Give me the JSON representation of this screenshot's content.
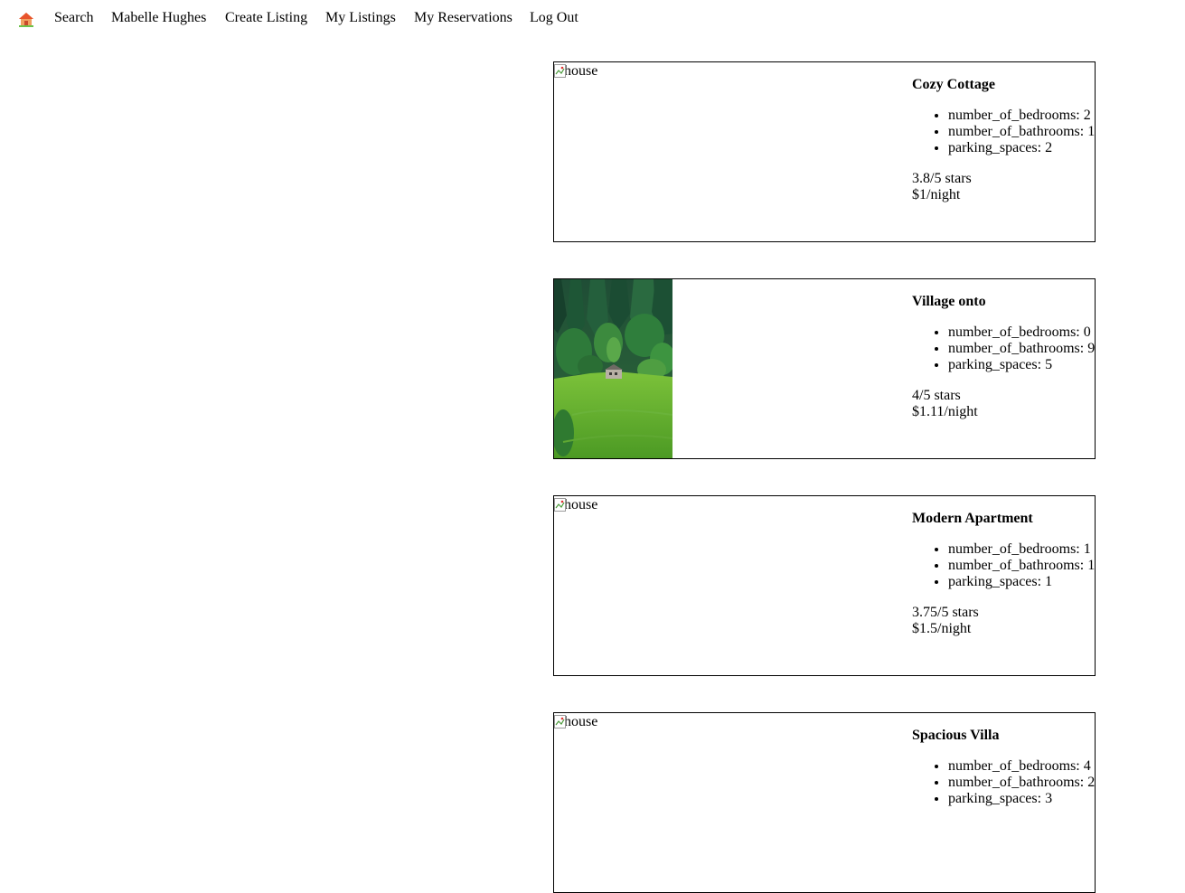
{
  "nav": {
    "home_icon": "home-icon",
    "links": [
      "Search",
      "Mabelle Hughes",
      "Create Listing",
      "My Listings",
      "My Reservations",
      "Log Out"
    ]
  },
  "listings": [
    {
      "image_alt": "house",
      "image_loaded": false,
      "title": "Cozy Cottage",
      "features": [
        "number_of_bedrooms: 2",
        "number_of_bathrooms: 1",
        "parking_spaces: 2"
      ],
      "rating": "3.8/5 stars",
      "price": "$1/night"
    },
    {
      "image_alt": "house",
      "image_loaded": true,
      "title": "Village onto",
      "features": [
        "number_of_bedrooms: 0",
        "number_of_bathrooms: 9",
        "parking_spaces: 5"
      ],
      "rating": "4/5 stars",
      "price": "$1.11/night"
    },
    {
      "image_alt": "house",
      "image_loaded": false,
      "title": "Modern Apartment",
      "features": [
        "number_of_bedrooms: 1",
        "number_of_bathrooms: 1",
        "parking_spaces: 1"
      ],
      "rating": "3.75/5 stars",
      "price": "$1.5/night"
    },
    {
      "image_alt": "house",
      "image_loaded": false,
      "title": "Spacious Villa",
      "features": [
        "number_of_bedrooms: 4",
        "number_of_bathrooms: 2",
        "parking_spaces: 3"
      ],
      "rating": "",
      "price": ""
    }
  ]
}
